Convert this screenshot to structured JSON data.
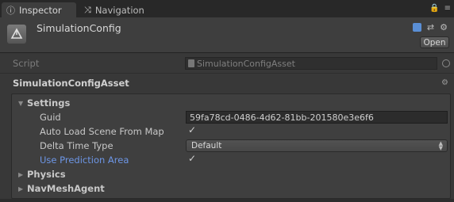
{
  "tabs": [
    {
      "label": "Inspector",
      "icon": "info-icon",
      "active": true
    },
    {
      "label": "Navigation",
      "icon": "navigation-icon",
      "active": false
    }
  ],
  "header": {
    "object_name": "SimulationConfig",
    "open_label": "Open"
  },
  "script": {
    "label": "Script",
    "value": "SimulationConfigAsset"
  },
  "component": {
    "title": "SimulationConfigAsset"
  },
  "settings": {
    "label": "Settings",
    "expanded": true,
    "guid_label": "Guid",
    "guid_value": "59fa78cd-0486-4d62-81bb-201580e3e6f6",
    "auto_load_label": "Auto Load Scene From Map",
    "auto_load_checked": true,
    "delta_time_label": "Delta Time Type",
    "delta_time_value": "Default",
    "use_prediction_label": "Use Prediction Area",
    "use_prediction_checked": true
  },
  "physics": {
    "label": "Physics",
    "expanded": false
  },
  "navmesh": {
    "label": "NavMeshAgent",
    "expanded": false
  },
  "colors": {
    "highlight": "#6d96e6",
    "background": "#383838"
  }
}
